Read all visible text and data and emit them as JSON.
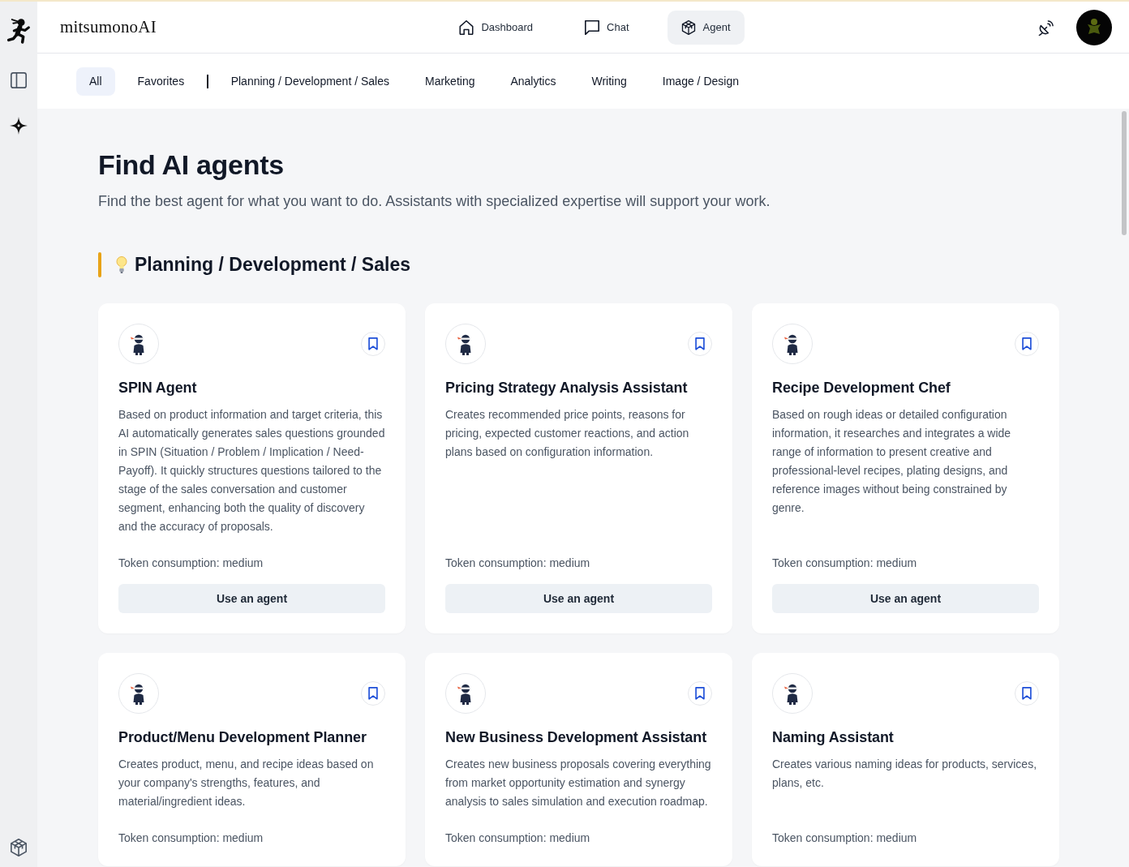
{
  "header": {
    "logo": "mitsumonoAI",
    "nav": [
      {
        "label": "Dashboard",
        "selected": false
      },
      {
        "label": "Chat",
        "selected": false
      },
      {
        "label": "Agent",
        "selected": true
      }
    ]
  },
  "filter_tabs": [
    {
      "label": "All",
      "selected": true
    },
    {
      "label": "Favorites",
      "selected": false
    }
  ],
  "category_tabs": [
    {
      "label": "Planning / Development / Sales",
      "selected": false
    },
    {
      "label": "Marketing",
      "selected": false
    },
    {
      "label": "Analytics",
      "selected": false
    },
    {
      "label": "Writing",
      "selected": false
    },
    {
      "label": "Image / Design",
      "selected": false
    }
  ],
  "page": {
    "title": "Find AI agents",
    "subtitle": "Find the best agent for what you want to do. Assistants with specialized expertise will support your work."
  },
  "sections": [
    {
      "title": "Planning / Development / Sales",
      "agents": [
        {
          "name": "SPIN Agent",
          "description": "Based on product information and target criteria, this AI automatically generates sales questions grounded in SPIN (Situation / Problem / Implication / Need-Payoff). It quickly structures questions tailored to the stage of the sales conversation and customer segment, enhancing both the quality of discovery and the accuracy of proposals.",
          "token_usage": "Token consumption: medium",
          "button": "Use an agent"
        },
        {
          "name": "Pricing Strategy Analysis Assistant",
          "description": "Creates recommended price points, reasons for pricing, expected customer reactions, and action plans based on configuration information.",
          "token_usage": "Token consumption: medium",
          "button": "Use an agent"
        },
        {
          "name": "Recipe Development Chef",
          "description": "Based on rough ideas or detailed configuration information, it researches and integrates a wide range of information to present creative and professional-level recipes, plating designs, and reference images without being constrained by genre.",
          "token_usage": "Token consumption: medium",
          "button": "Use an agent"
        },
        {
          "name": "Product/Menu Development Planner",
          "description": "Creates product, menu, and recipe ideas based on your company's strengths, features, and material/ingredient ideas.",
          "token_usage": "Token consumption: medium"
        },
        {
          "name": "New Business Development Assistant",
          "description": "Creates new business proposals covering everything from market opportunity estimation and synergy analysis to sales simulation and execution roadmap.",
          "token_usage": "Token consumption: medium"
        },
        {
          "name": "Naming Assistant",
          "description": "Creates various naming ideas for products, services, plans, etc.",
          "token_usage": "Token consumption: medium"
        }
      ]
    }
  ]
}
